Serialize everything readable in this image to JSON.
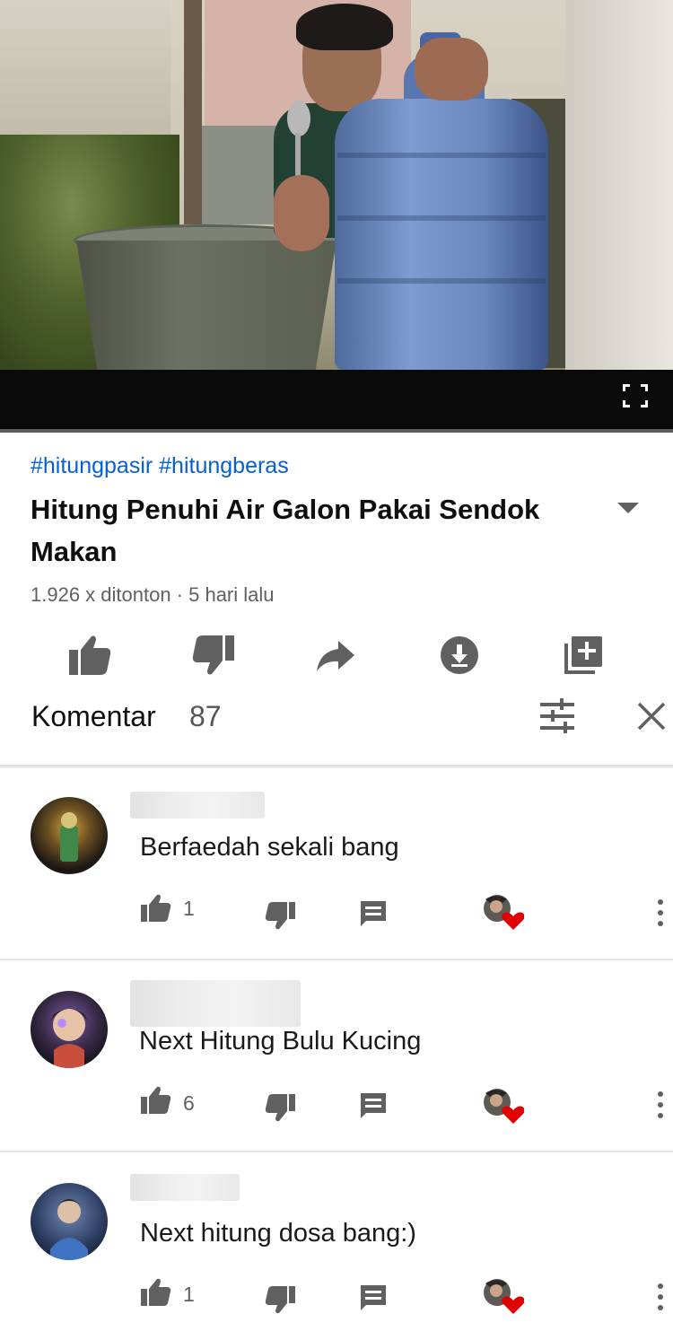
{
  "video": {
    "hashtags": "#hitungpasir #hitungberas",
    "title": "Hitung Penuhi Air Galon Pakai Sendok Makan",
    "meta": "1.926 x ditonton · 5 hari lalu",
    "progress_fraction": 0.0
  },
  "actions": [
    {
      "icon": "thumb-up-icon"
    },
    {
      "icon": "thumb-down-icon"
    },
    {
      "icon": "share-icon"
    },
    {
      "icon": "download-icon"
    },
    {
      "icon": "add-to-playlist-icon"
    }
  ],
  "comments_header": {
    "label": "Komentar",
    "count": "87"
  },
  "comments": [
    {
      "text": "Berfaedah sekali bang",
      "likes": "1"
    },
    {
      "text": "Next Hitung Bulu Kucing",
      "likes": "6"
    },
    {
      "text": "Next hitung dosa bang:)",
      "likes": "1"
    }
  ],
  "colors": {
    "hashtag": "#065fd4",
    "icon": "#606060",
    "heart": "#e00000"
  }
}
